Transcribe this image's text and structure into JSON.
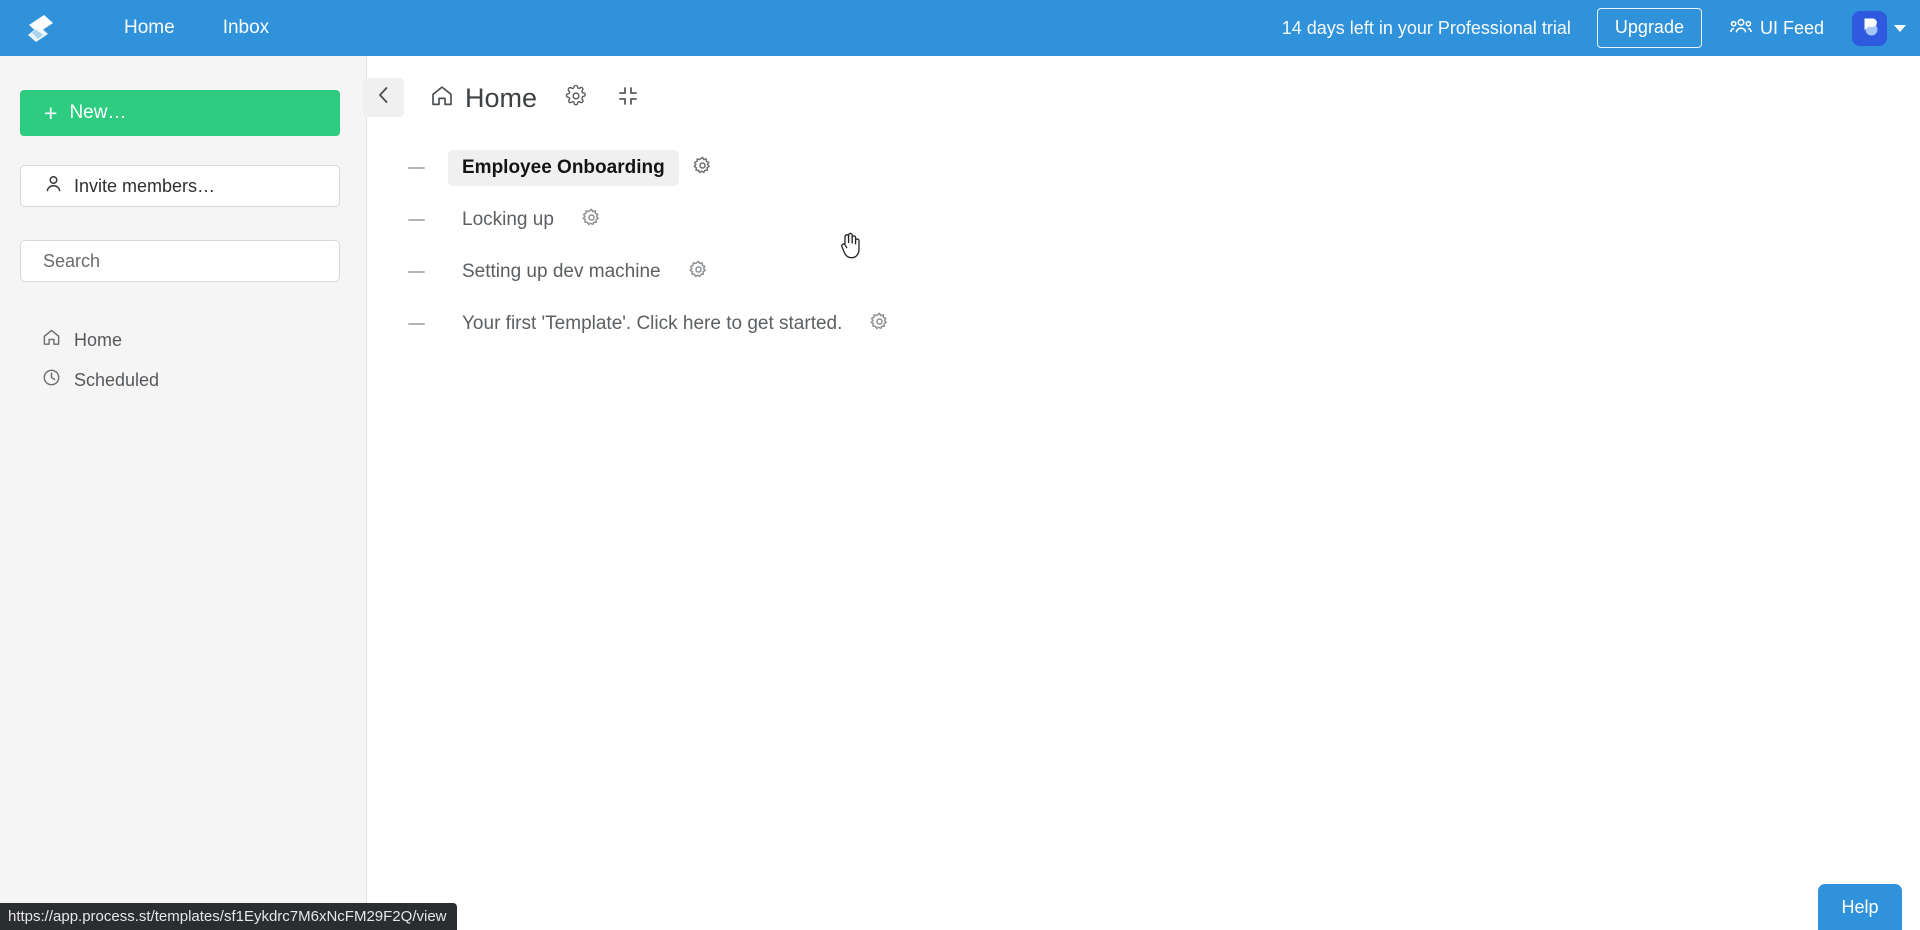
{
  "topbar": {
    "logo_icon": "process-st-logo-icon",
    "nav": [
      {
        "label": "Home"
      },
      {
        "label": "Inbox"
      }
    ],
    "trial_text": "14 days left in your Professional trial",
    "upgrade_label": "Upgrade",
    "ui_feed_label": "UI Feed",
    "ui_feed_icon": "people-group-icon",
    "avatar_icon": "chat-bubble-avatar-icon",
    "caret_icon": "chevron-down-icon",
    "bg_color": "#3092DB"
  },
  "sidebar": {
    "new_button": {
      "label": "New…",
      "icon": "plus-icon",
      "color": "#2ECC80"
    },
    "invite_button": {
      "label": "Invite members…",
      "icon": "person-icon"
    },
    "search": {
      "placeholder": "Search",
      "value": ""
    },
    "items": [
      {
        "label": "Home",
        "icon": "home-icon"
      },
      {
        "label": "Scheduled",
        "icon": "clock-icon"
      }
    ]
  },
  "content": {
    "collapse_icon": "chevron-left-icon",
    "home_icon": "home-icon",
    "title": "Home",
    "settings_icon": "gear-icon",
    "collapse_all_icon": "collapse-inward-icon",
    "rows": [
      {
        "label": "Employee Onboarding",
        "gear_icon": "gear-icon",
        "bullet_icon": "dash-icon",
        "active": true
      },
      {
        "label": "Locking up",
        "gear_icon": "gear-icon",
        "bullet_icon": "dash-icon",
        "active": false
      },
      {
        "label": "Setting up dev machine",
        "gear_icon": "gear-icon",
        "bullet_icon": "dash-icon",
        "active": false
      },
      {
        "label": "Your first 'Template'. Click here to get started.",
        "gear_icon": "gear-icon",
        "bullet_icon": "dash-icon",
        "active": false
      }
    ]
  },
  "status_bar": {
    "url": "https://app.process.st/templates/sf1Eykdrc7M6xNcFM29F2Q/view"
  },
  "help": {
    "label": "Help",
    "color": "#3092DB"
  }
}
